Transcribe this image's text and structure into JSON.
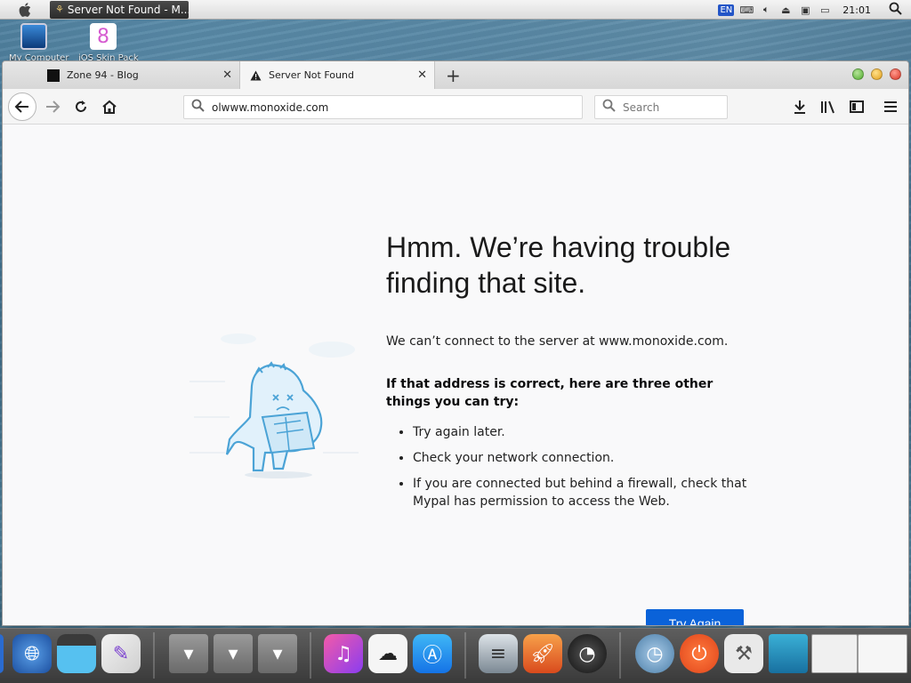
{
  "menubar": {
    "task_title": "Server Not Found - M...",
    "lang": "EN",
    "clock": "21:01"
  },
  "desktop_icons": [
    {
      "label": "My Computer"
    },
    {
      "label": "iOS Skin Pack"
    }
  ],
  "browser": {
    "tabs": [
      {
        "title": "Zone 94 - Blog",
        "close": "✕"
      },
      {
        "title": "Server Not Found",
        "close": "✕"
      }
    ],
    "new_tab": "+",
    "url": "olwww.monoxide.com",
    "search_placeholder": "Search"
  },
  "page": {
    "heading": "Hmm. We’re having trouble finding that site.",
    "description": "We can’t connect to the server at www.monoxide.com.",
    "suggestions_heading": "If that address is correct, here are three other things you can try:",
    "suggestions": [
      "Try again later.",
      "Check your network connection.",
      "If you are connected but behind a firewall, check that Mypal has permission to access the Web."
    ],
    "try_again": "Try Again"
  },
  "colors": {
    "accent": "#0a62d9",
    "tab_bar": "#d7d7d7",
    "dock": "#3a3a3a"
  },
  "icons": {
    "back": "arrow-left-icon",
    "forward": "arrow-right-icon",
    "reload": "reload-icon",
    "home": "home-icon",
    "download": "download-icon",
    "library": "library-icon",
    "sidebar": "sidebar-icon",
    "menu": "hamburger-menu-icon"
  }
}
